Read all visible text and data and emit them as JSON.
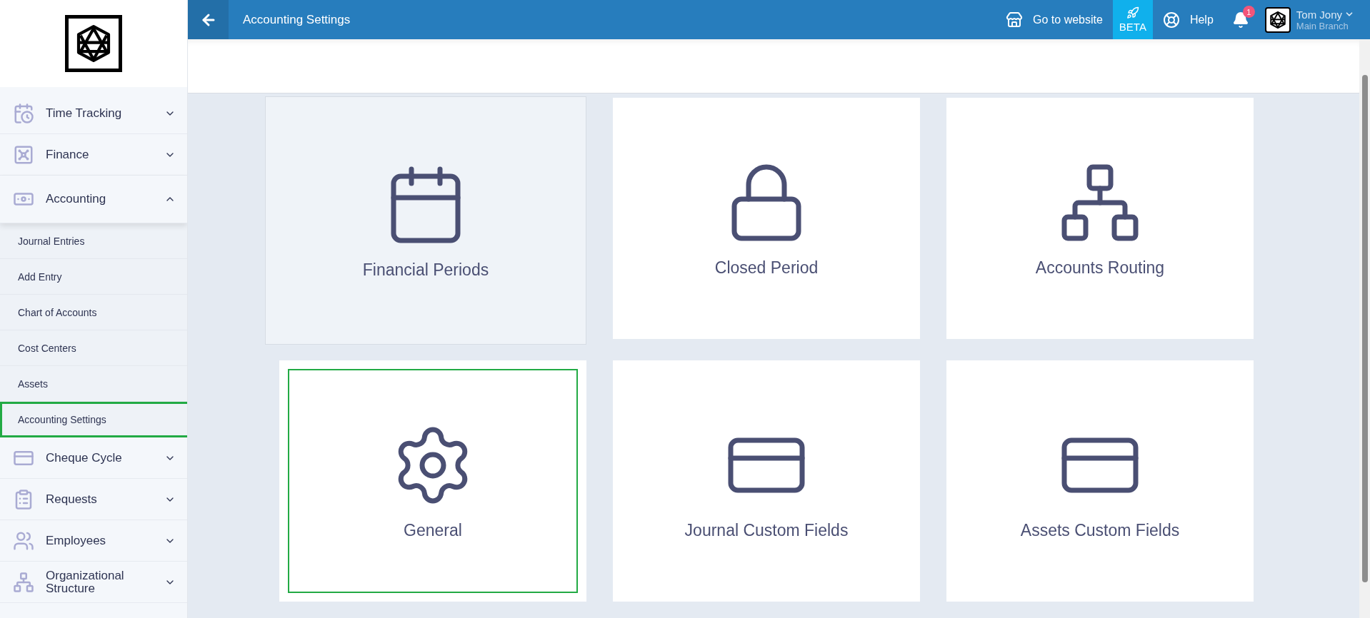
{
  "header": {
    "title": "Accounting Settings",
    "website": "Go to website",
    "beta": "BETA",
    "help": "Help",
    "notifications": "1",
    "user": {
      "name": "Tom Jony",
      "branch": "Main Branch"
    }
  },
  "sidebar": {
    "items": [
      {
        "label": "Time Tracking",
        "expanded": false
      },
      {
        "label": "Finance",
        "expanded": false
      },
      {
        "label": "Accounting",
        "expanded": true,
        "children": [
          {
            "label": "Journal Entries",
            "highlighted": false
          },
          {
            "label": "Add Entry",
            "highlighted": false
          },
          {
            "label": "Chart of Accounts",
            "highlighted": false
          },
          {
            "label": "Cost Centers",
            "highlighted": false
          },
          {
            "label": "Assets",
            "highlighted": false
          },
          {
            "label": "Accounting Settings",
            "highlighted": true
          }
        ]
      },
      {
        "label": "Cheque Cycle",
        "expanded": false
      },
      {
        "label": "Requests",
        "expanded": false
      },
      {
        "label": "Employees",
        "expanded": false
      },
      {
        "label": "Organizational Structure",
        "expanded": false
      }
    ]
  },
  "cards": [
    {
      "label": "Financial Periods",
      "hovered": true,
      "highlighted": false
    },
    {
      "label": "Closed Period",
      "hovered": false,
      "highlighted": false
    },
    {
      "label": "Accounts Routing",
      "hovered": false,
      "highlighted": false
    },
    {
      "label": "General",
      "hovered": false,
      "highlighted": true
    },
    {
      "label": "Journal Custom Fields",
      "hovered": false,
      "highlighted": false
    },
    {
      "label": "Assets Custom Fields",
      "hovered": false,
      "highlighted": false
    }
  ]
}
